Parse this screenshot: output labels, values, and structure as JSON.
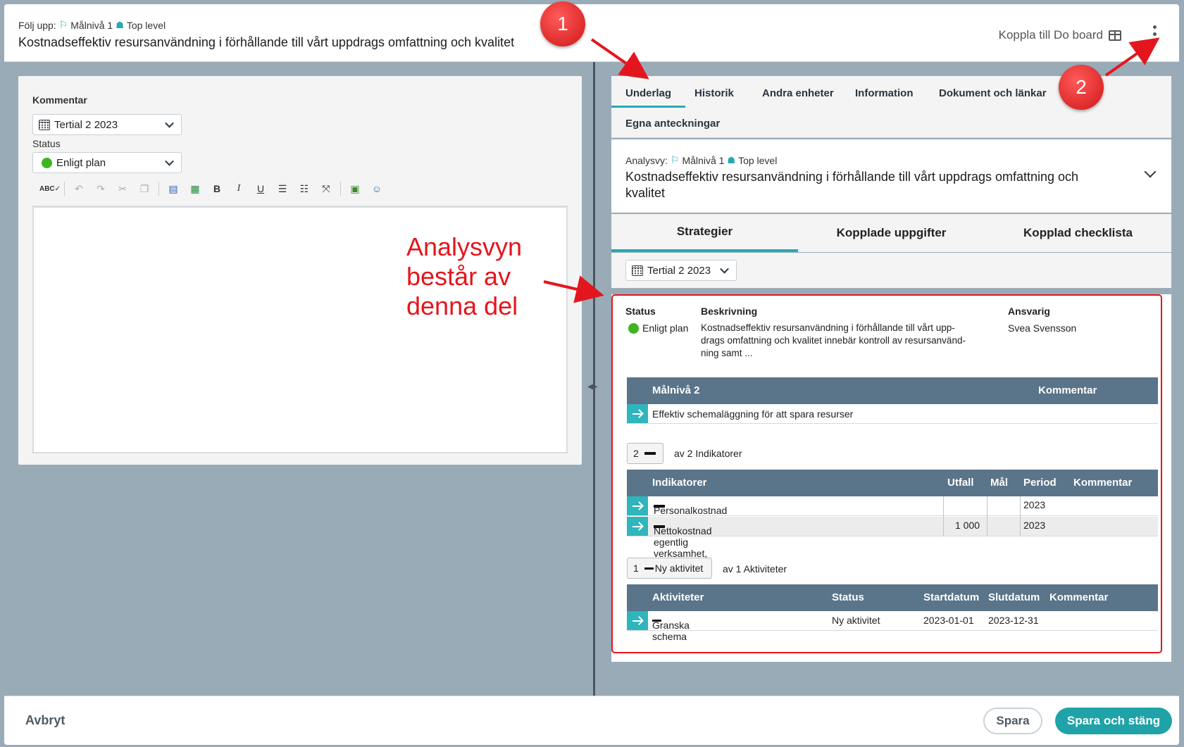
{
  "header": {
    "crumb_prefix": "Följ upp:",
    "crumb_level": "Målnivå 1",
    "crumb_root": "Top level",
    "title": "Kostnadseffektiv resursanvändning i förhållande till vårt uppdrags omfattning och kvalitet",
    "doboard_label": "Koppla till Do board"
  },
  "left": {
    "comment_label": "Kommentar",
    "period_value": "Tertial 2 2023",
    "status_label": "Status",
    "status_value": "Enligt plan",
    "toolbar": [
      "spellcheck",
      "undo",
      "redo",
      "cut",
      "copy",
      "paste-word",
      "paste-excel",
      "B",
      "I",
      "U",
      "ordered-list",
      "bullet-list",
      "fullscreen",
      "image",
      "person"
    ]
  },
  "tabs": {
    "items": [
      "Underlag",
      "Historik",
      "Andra enheter",
      "Information",
      "Dokument och länkar",
      "Egna anteckningar"
    ]
  },
  "analys": {
    "prefix": "Analysvy:",
    "level": "Målnivå 1",
    "root": "Top level",
    "title": "Kostnadseffektiv resursanvändning i förhållande till vårt uppdrags omfattning och kvalitet"
  },
  "subtabs": [
    "Strategier",
    "Kopplade uppgifter",
    "Kopplad checklista"
  ],
  "period": "Tertial 2 2023",
  "strategy": {
    "status_header": "Status",
    "desc_header": "Beskrivning",
    "owner_header": "Ansvarig",
    "status": "Enligt plan",
    "desc_lines": [
      "Kostnadseffektiv resursanvändning i förhållande till vårt upp-",
      "drags omfattning och kvalitet innebär kontroll av resursanvänd-",
      "ning samt ..."
    ],
    "owner": "Svea Svensson"
  },
  "goals": {
    "headers": [
      "Målnivå 2",
      "Kommentar"
    ],
    "rows": [
      {
        "name": "Effektiv schemaläggning för att spara resurser",
        "comment": ""
      }
    ]
  },
  "indicators": {
    "pager_value": "2",
    "pager_text": "av 2 Indikatorer",
    "headers": [
      "Indikatorer",
      "Utfall",
      "Mål",
      "Period",
      "Kommentar"
    ],
    "rows": [
      {
        "name": "Personalkostnad",
        "utfall": "",
        "mal": "",
        "period": "2023",
        "comment": ""
      },
      {
        "name": "Nettokostnad egentlig verksamhet, kr/inv",
        "utfall": "1 000",
        "mal": "",
        "period": "2023",
        "comment": ""
      }
    ]
  },
  "activities": {
    "pager_value": "1",
    "pager_status": "Ny aktivitet",
    "pager_text": "av 1 Aktiviteter",
    "headers": [
      "Aktiviteter",
      "Status",
      "Startdatum",
      "Slutdatum",
      "Kommentar"
    ],
    "rows": [
      {
        "name": "Granska schema",
        "status": "Ny aktivitet",
        "start": "2023-01-01",
        "end": "2023-12-31",
        "comment": ""
      }
    ]
  },
  "footer": {
    "cancel": "Avbryt",
    "save": "Spara",
    "save_close": "Spara och stäng"
  },
  "annotations": {
    "badge1": "1",
    "badge2": "2",
    "note_lines": [
      "Analysvyn",
      "består av",
      "denna del"
    ],
    "color": "#e4161d"
  },
  "colors": {
    "accent": "#26a9b4",
    "grid_header": "#5a7489",
    "status_green": "#3cb521",
    "primary_button": "#20a3a8"
  }
}
